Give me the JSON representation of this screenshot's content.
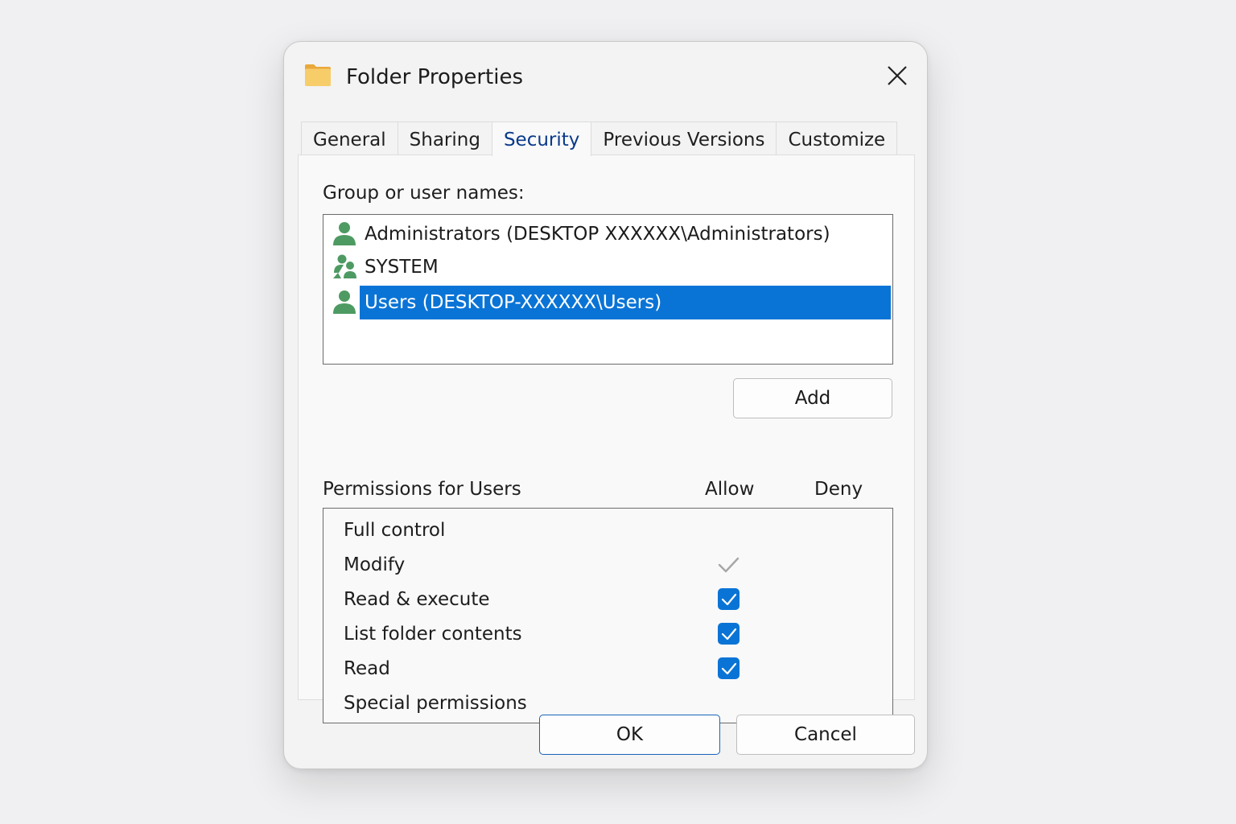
{
  "window": {
    "title": "Folder Properties",
    "icon": "folder-icon",
    "close_icon": "close-icon"
  },
  "tabs": [
    {
      "label": "General",
      "active": false
    },
    {
      "label": "Sharing",
      "active": false
    },
    {
      "label": "Security",
      "active": true
    },
    {
      "label": "Previous Versions",
      "active": false
    },
    {
      "label": "Customize",
      "active": false
    }
  ],
  "security": {
    "group_label": "Group or user names:",
    "users": [
      {
        "name": "Administrators (DESKTOP XXXXXX\\Administrators)",
        "icon": "user-icon",
        "selected": false
      },
      {
        "name": "SYSTEM",
        "icon": "group-icon",
        "selected": false
      },
      {
        "name": "Users (DESKTOP-XXXXXX\\Users)",
        "icon": "user-icon",
        "selected": true
      }
    ],
    "add_label": "Add",
    "permissions_label": "Permissions for Users",
    "allow_label": "Allow",
    "deny_label": "Deny",
    "permissions": [
      {
        "name": "Full control",
        "allow": "none",
        "deny": "none"
      },
      {
        "name": "Modify",
        "allow": "inherited",
        "deny": "none"
      },
      {
        "name": "Read & execute",
        "allow": "checked",
        "deny": "none"
      },
      {
        "name": "List folder contents",
        "allow": "checked",
        "deny": "none"
      },
      {
        "name": "Read",
        "allow": "checked",
        "deny": "none"
      },
      {
        "name": "Special permissions",
        "allow": "none",
        "deny": "none"
      }
    ]
  },
  "footer": {
    "ok_label": "OK",
    "cancel_label": "Cancel"
  },
  "colors": {
    "accent": "#0a74d6",
    "user_icon": "#4e9a63",
    "folder": "#f3c35a"
  }
}
